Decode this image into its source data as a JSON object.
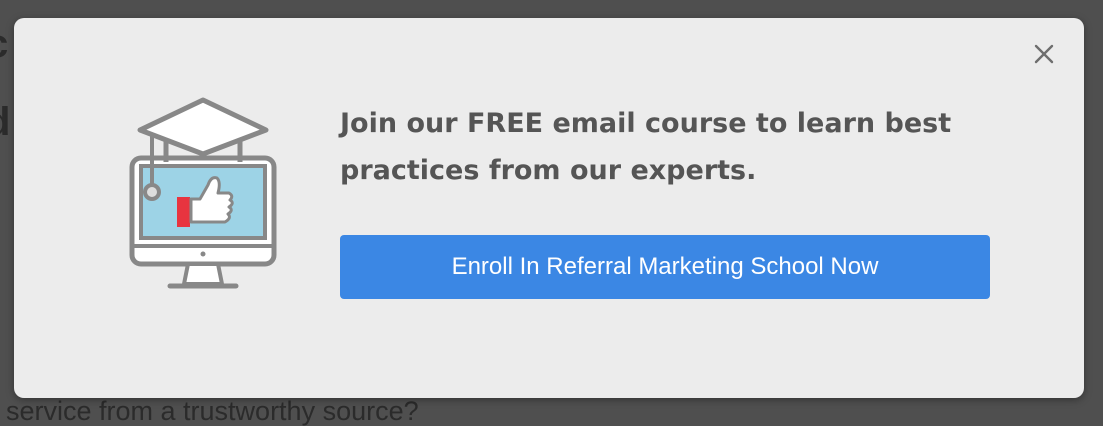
{
  "backdrop": {
    "line_4": "service from a trustworthy source?"
  },
  "modal": {
    "headline": "Join our FREE email course to learn best practices from our experts.",
    "cta_label": "Enroll In Referral Marketing School Now",
    "close_label": "×",
    "illustration_icon": "graduation-cap-monitor-thumbs-up-icon"
  },
  "colors": {
    "overlay": "#4f4f4f",
    "modal_bg": "#ececec",
    "cta_bg": "#3b87e4",
    "cta_text": "#ffffff",
    "headline_text": "#555555",
    "icon_stroke": "#888888",
    "screen_fill": "#9dd3e6",
    "accent_red": "#e8343f"
  }
}
